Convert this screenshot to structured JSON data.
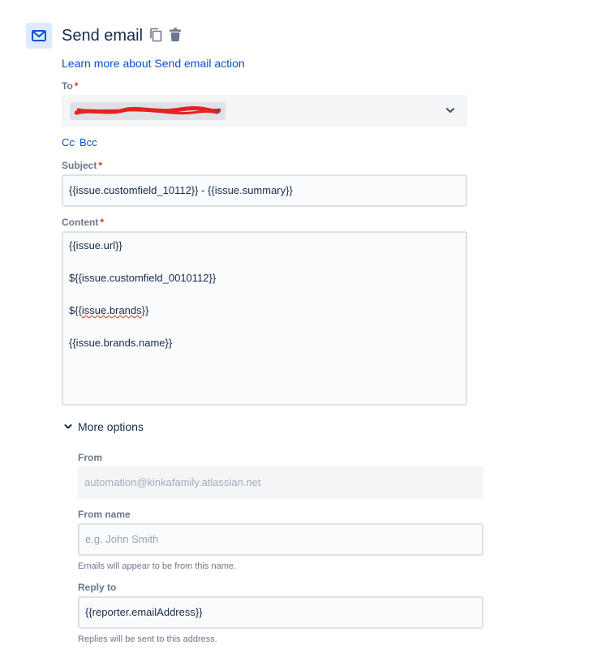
{
  "header": {
    "title": "Send email",
    "learn_more": "Learn more about Send email action",
    "icons": [
      "envelope-icon",
      "copy-icon",
      "trash-icon"
    ]
  },
  "to": {
    "label": "To",
    "required_mark": "*",
    "chip_remove": "×"
  },
  "cc_bcc": {
    "cc": "Cc",
    "bcc": "Bcc"
  },
  "subject": {
    "label": "Subject",
    "required_mark": "*",
    "value": "{{issue.customfield_10112}} - {{issue.summary}}"
  },
  "content": {
    "label": "Content",
    "required_mark": "*",
    "lines": [
      "{{issue.url}}",
      "${{issue.customfield_0010112}}",
      "${{issue.brands}}",
      "{{issue.brands.name}}"
    ]
  },
  "more_options": {
    "toggle_label": "More options",
    "from": {
      "label": "From",
      "value": "automation@kinkafamily.atlassian.net"
    },
    "from_name": {
      "label": "From name",
      "placeholder": "e.g. John Smith",
      "helper": "Emails will appear to be from this name."
    },
    "reply_to": {
      "label": "Reply to",
      "value": "{{reporter.emailAddress}}",
      "helper": "Replies will be sent to this address."
    }
  },
  "colors": {
    "link": "#0052CC",
    "required": "#DE350B",
    "text": "#172B4D",
    "muted": "#6B778C",
    "icon_bg": "#DEEBFF"
  }
}
